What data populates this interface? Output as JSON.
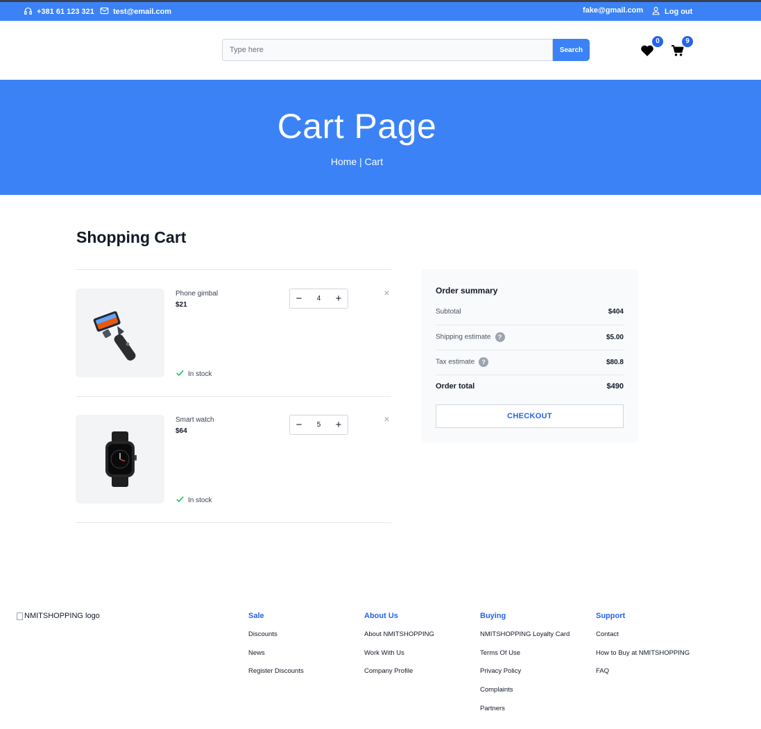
{
  "topbar": {
    "phone": "+381 61 123 321",
    "email": "test@email.com",
    "user_email": "fake@gmail.com",
    "logout_label": "Log out"
  },
  "header": {
    "search_placeholder": "Type here",
    "search_button": "Search",
    "wishlist_count": "0",
    "cart_count": "9"
  },
  "hero": {
    "title": "Cart Page",
    "breadcrumb_home": "Home",
    "breadcrumb_separator": "|",
    "breadcrumb_current": "Cart"
  },
  "cart": {
    "title": "Shopping Cart",
    "items": [
      {
        "name": "Phone gimbal",
        "price": "$21",
        "quantity": "4",
        "stock": "In stock",
        "minus": "−",
        "plus": "+",
        "remove": "×"
      },
      {
        "name": "Smart watch",
        "price": "$64",
        "quantity": "5",
        "stock": "In stock",
        "minus": "−",
        "plus": "+",
        "remove": "×"
      }
    ]
  },
  "summary": {
    "title": "Order summary",
    "subtotal_label": "Subtotal",
    "subtotal_value": "$404",
    "shipping_label": "Shipping estimate",
    "shipping_value": "$5.00",
    "tax_label": "Tax estimate",
    "tax_value": "$80.8",
    "total_label": "Order total",
    "total_value": "$490",
    "help_glyph": "?",
    "checkout_label": "CHECKOUT"
  },
  "footer": {
    "logo_alt": "NMITSHOPPING logo",
    "columns": [
      {
        "title": "Sale",
        "links": [
          "Discounts",
          "News",
          "Register Discounts"
        ]
      },
      {
        "title": "About Us",
        "links": [
          "About NMITSHOPPING",
          "Work With Us",
          "Company Profile"
        ]
      },
      {
        "title": "Buying",
        "links": [
          "NMITSHOPPING Loyalty Card",
          "Terms Of Use",
          "Privacy Policy",
          "Complaints",
          "Partners"
        ]
      },
      {
        "title": "Support",
        "links": [
          "Contact",
          "How to Buy at NMITSHOPPING",
          "FAQ"
        ]
      }
    ]
  },
  "colors": {
    "brand": "#3b82f6",
    "accent": "#2563eb",
    "success": "#22c55e"
  },
  "icons": [
    "headset-icon",
    "mail-icon",
    "user-icon",
    "heart-icon",
    "cart-icon",
    "check-icon",
    "close-icon",
    "help-icon"
  ]
}
